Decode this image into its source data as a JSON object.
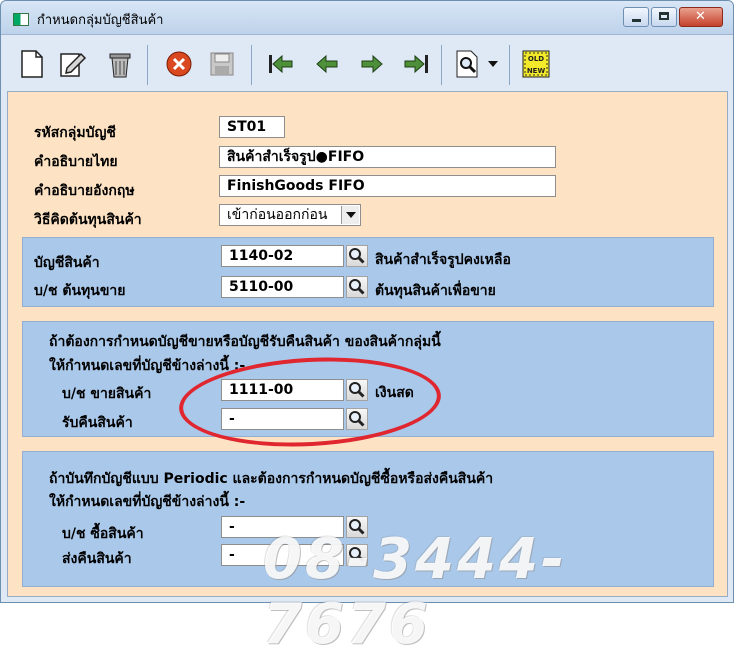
{
  "window": {
    "title": "กำหนดกลุ่มบัญชีสินค้า"
  },
  "toolbar_icons": [
    "new-document-icon",
    "edit-icon",
    "trash-icon",
    "cancel-icon",
    "save-icon",
    "first-record-icon",
    "previous-record-icon",
    "next-record-icon",
    "last-record-icon",
    "search-icon",
    "dropdown-arrow-icon",
    "old-new-icon"
  ],
  "toolbar": {
    "old_new_top": "OLD",
    "old_new_bottom": "NEW"
  },
  "form": {
    "group_code": {
      "label": "รหัสกลุ่มบัญชี",
      "value": "ST01"
    },
    "thai_desc": {
      "label": "คำอธิบายไทย",
      "value": "สินค้าสำเร็จรูป●FIFO"
    },
    "eng_desc": {
      "label": "คำอธิบายอังกฤษ",
      "value": "FinishGoods FIFO"
    },
    "cost_method": {
      "label": "วิธีคิดต้นทุนสินค้า",
      "value": "เข้าก่อนออกก่อน"
    }
  },
  "panel1": {
    "inventory": {
      "label": "บัญชีสินค้า",
      "code": "1140-02",
      "desc": "สินค้าสำเร็จรูปคงเหลือ"
    },
    "cogs": {
      "label": "บ/ช ต้นทุนขาย",
      "code": "5110-00",
      "desc": "ต้นทุนสินค้าเพื่อขาย"
    }
  },
  "panel2": {
    "line1": "ถ้าต้องการกำหนดบัญชีขายหรือบัญชีรับคืนสินค้า ของสินค้ากลุ่มนี้",
    "line2": "ให้กำหนดเลขที่บัญชีข้างล่างนี้ :-",
    "sales": {
      "label": "บ/ช ขายสินค้า",
      "code": "1111-00",
      "desc": "เงินสด"
    },
    "returns": {
      "label": "รับคืนสินค้า",
      "code": "-"
    }
  },
  "panel3": {
    "line1": "ถ้าบันทึกบัญชีแบบ Periodic และต้องการกำหนดบัญชีซื้อหรือส่งคืนสินค้า",
    "line2": "ให้กำหนดเลขที่บัญชีข้างล่างนี้ :-",
    "purchases": {
      "label": "บ/ช ซื้อสินค้า",
      "code": "-"
    },
    "return_out": {
      "label": "ส่งคืนสินค้า",
      "code": "-"
    }
  },
  "watermark": "08-3444-7676",
  "colors": {
    "form_bg": "#fde3c3",
    "panel_bg": "#a9c8ea",
    "highlight": "#e0262f"
  }
}
